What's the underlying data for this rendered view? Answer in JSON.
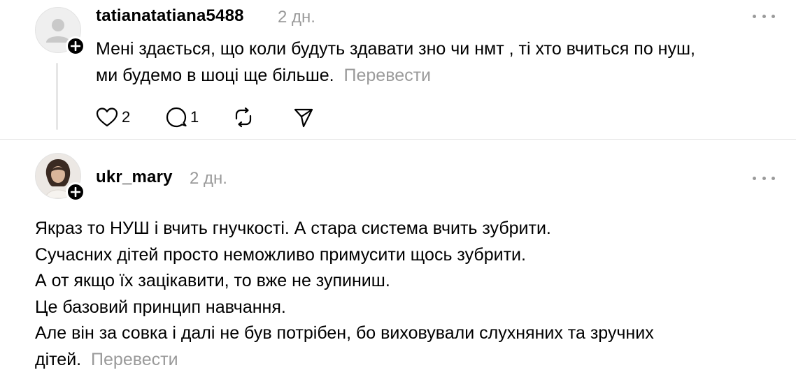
{
  "comments": [
    {
      "username": "tatianatatiana5488",
      "time": "2 дн.",
      "text_lines": [
        "Мені здається, що коли будуть здавати зно чи нмт , ті хто вчиться по нуш,",
        "ми будемо в шоці ще більше."
      ],
      "translate_label": "Перевести",
      "likes": "2",
      "replies": "1",
      "avatar_icon": "default-person-icon"
    },
    {
      "username": "ukr_mary",
      "time": "2 дн.",
      "text_lines": [
        "Якраз то НУШ і вчить гнучкості. А стара система вчить зубрити.",
        "Сучасних дітей просто неможливо примусити щось зубрити.",
        "А от якщо їх зацікавити, то вже не зупиниш.",
        "Це базовий принцип навчання.",
        "Але він за совка і далі не був потрібен, бо виховували слухняних та зручних",
        "дітей."
      ],
      "translate_label": "Перевести",
      "avatar_icon": "user-photo"
    }
  ],
  "icons": {
    "like": "heart-icon",
    "reply": "comment-icon",
    "repost": "repost-icon",
    "share": "send-icon",
    "more": "more-options-icon",
    "follow": "plus-icon"
  },
  "colors": {
    "text": "#000000",
    "muted": "#9a9a9a",
    "thread_line": "#e6e6e6"
  }
}
